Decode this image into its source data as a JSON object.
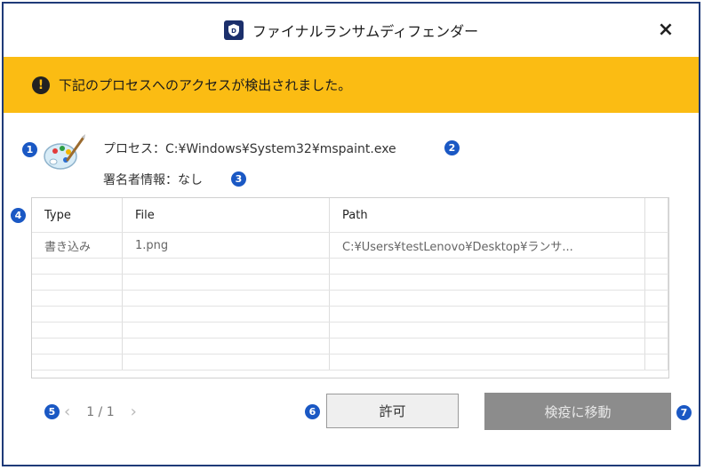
{
  "window": {
    "title": "ファイナルランサムディフェンダー",
    "close_label": "×"
  },
  "alert": {
    "icon": "exclamation-circle-icon",
    "message": "下記のプロセスへのアクセスが検出されました。",
    "color": "#fbbc13"
  },
  "process": {
    "icon": "paint-palette-icon",
    "label": "プロセス：C:¥Windows¥System32¥mspaint.exe",
    "signer_label": "署名者情報：なし"
  },
  "table": {
    "headers": [
      "Type",
      "File",
      "Path"
    ],
    "rows": [
      {
        "type": "書き込み",
        "file": "1.png",
        "path": "C:¥Users¥testLenovo¥Desktop¥ランサ..."
      }
    ]
  },
  "pager": {
    "prev": "‹",
    "text": "1 / 1",
    "next": "›"
  },
  "buttons": {
    "allow": "許可",
    "quarantine": "検疫に移動"
  },
  "callouts": [
    "1",
    "2",
    "3",
    "4",
    "5",
    "6",
    "7"
  ],
  "colors": {
    "border": "#1f3a78",
    "callout": "#1a58c4",
    "quarantine_button": "#8c8c8c"
  }
}
